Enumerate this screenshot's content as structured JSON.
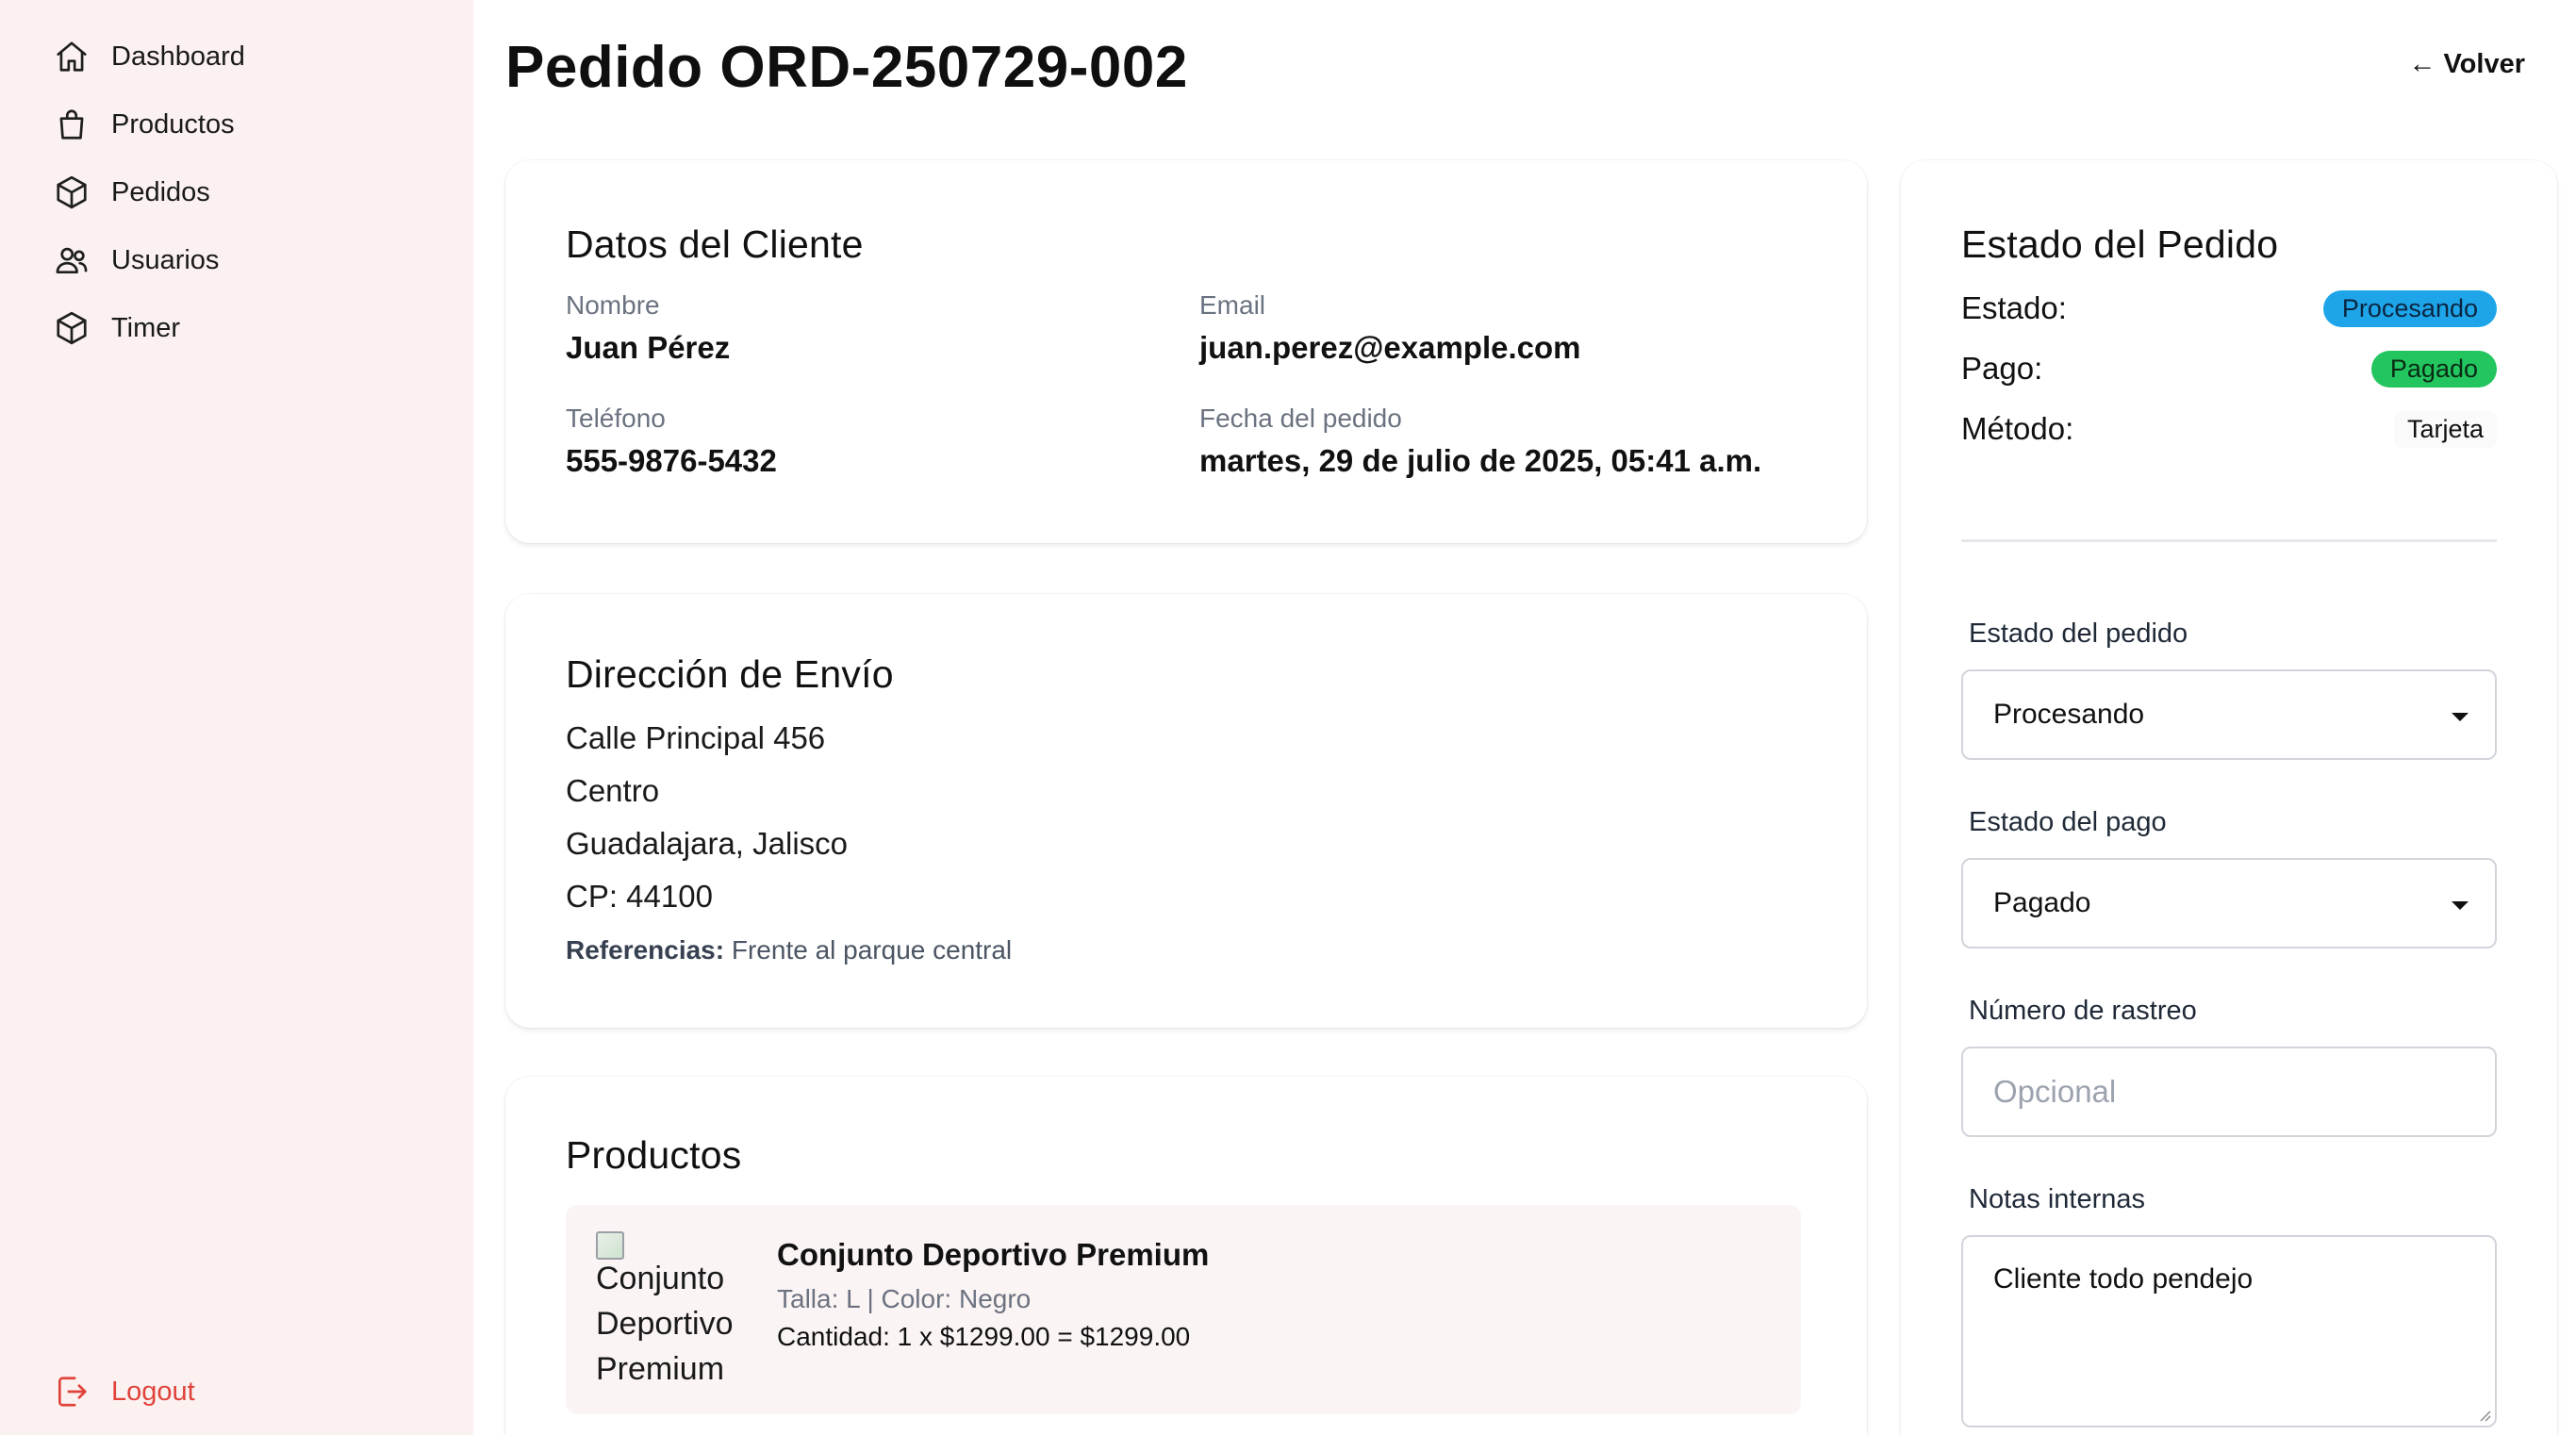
{
  "sidebar": {
    "items": [
      {
        "label": "Dashboard",
        "icon": "home-icon"
      },
      {
        "label": "Productos",
        "icon": "shopping-bag-icon"
      },
      {
        "label": "Pedidos",
        "icon": "package-icon"
      },
      {
        "label": "Usuarios",
        "icon": "users-icon"
      },
      {
        "label": "Timer",
        "icon": "package-icon"
      }
    ],
    "logout_label": "Logout"
  },
  "header": {
    "title": "Pedido ORD-250729-002",
    "back_label": "← Volver"
  },
  "customer": {
    "title": "Datos del Cliente",
    "name_label": "Nombre",
    "name": "Juan Pérez",
    "email_label": "Email",
    "email": "juan.perez@example.com",
    "phone_label": "Teléfono",
    "phone": "555-9876-5432",
    "date_label": "Fecha del pedido",
    "date": "martes, 29 de julio de 2025, 05:41 a.m."
  },
  "shipping": {
    "title": "Dirección de Envío",
    "street": "Calle Principal 456",
    "neighborhood": "Centro",
    "city_state": "Guadalajara, Jalisco",
    "zip": "CP: 44100",
    "references_label": "Referencias:",
    "references": "Frente al parque central"
  },
  "products": {
    "title": "Productos",
    "items": [
      {
        "image_alt": "Conjunto Deportivo Premium",
        "name": "Conjunto Deportivo Premium",
        "variant": "Talla: L | Color: Negro",
        "quantity_line": "Cantidad: 1 x $1299.00 = $1299.00"
      }
    ]
  },
  "status_panel": {
    "title": "Estado del Pedido",
    "estado_label": "Estado:",
    "estado_value": "Procesando",
    "pago_label": "Pago:",
    "pago_value": "Pagado",
    "metodo_label": "Método:",
    "metodo_value": "Tarjeta",
    "order_status_label": "Estado del pedido",
    "order_status_value": "Procesando",
    "payment_status_label": "Estado del pago",
    "payment_status_value": "Pagado",
    "tracking_label": "Número de rastreo",
    "tracking_placeholder": "Opcional",
    "notes_label": "Notas internas",
    "notes_value": "Cliente todo pendejo"
  },
  "colors": {
    "sidebar_bg": "#fbf1f1",
    "badge_processing": "#1ea5e9",
    "badge_paid": "#22c55e",
    "logout": "#e0433a"
  }
}
